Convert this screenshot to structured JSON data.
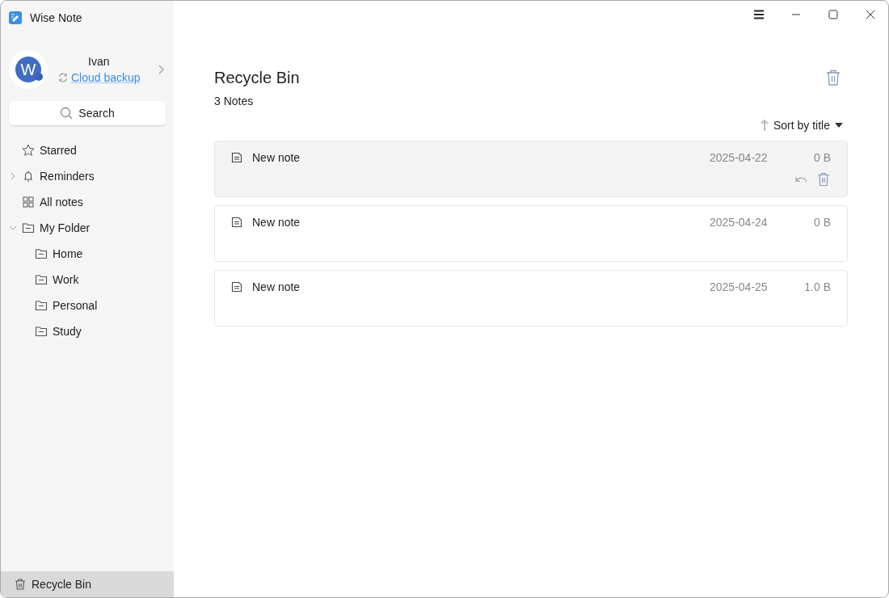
{
  "window": {
    "title": "Wise Note"
  },
  "profile": {
    "avatar_letter": "W",
    "name": "Ivan",
    "backup_link": "Cloud backup"
  },
  "search": {
    "label": "Search"
  },
  "nav": [
    {
      "kind": "star",
      "label": "Starred"
    },
    {
      "kind": "bell",
      "label": "Reminders",
      "expanded": false
    },
    {
      "kind": "grid",
      "label": "All notes"
    },
    {
      "kind": "folder",
      "label": "My Folder",
      "expanded": true,
      "children": [
        {
          "kind": "folder",
          "label": "Home"
        },
        {
          "kind": "folder",
          "label": "Work"
        },
        {
          "kind": "folder",
          "label": "Personal"
        },
        {
          "kind": "folder",
          "label": "Study"
        }
      ]
    }
  ],
  "bottom_item": {
    "label": "Recycle Bin",
    "selected": true
  },
  "page": {
    "title": "Recycle Bin",
    "count": "3 Notes",
    "sort": "Sort by title"
  },
  "notes": [
    {
      "title": "New note",
      "date": "2025-04-22",
      "size": "0 B",
      "selected": true
    },
    {
      "title": "New note",
      "date": "2025-04-24",
      "size": "0 B",
      "selected": false
    },
    {
      "title": "New note",
      "date": "2025-04-25",
      "size": "1.0 B",
      "selected": false
    }
  ]
}
